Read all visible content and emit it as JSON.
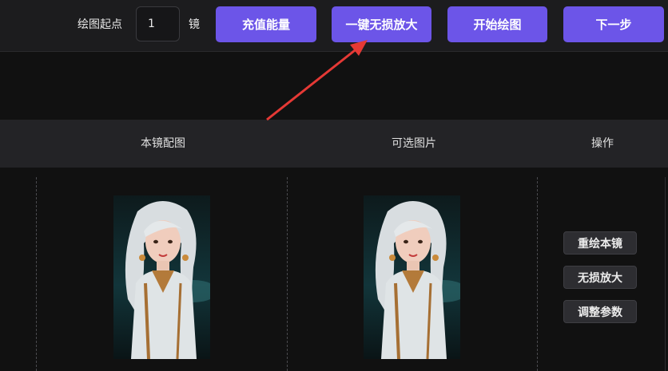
{
  "toolbar": {
    "start_label": "绘图起点",
    "start_value": "1",
    "unit_label": "镜",
    "recharge_label": "充值能量",
    "upscale_all_label": "一键无损放大",
    "start_draw_label": "开始绘图",
    "next_label": "下一步"
  },
  "table": {
    "columns": [
      "本镜配图",
      "可选图片",
      "操作"
    ],
    "row": {
      "actions": [
        "重绘本镜",
        "无损放大",
        "调整参数"
      ]
    }
  },
  "colors": {
    "accent": "#6c55e8",
    "annotation_arrow": "#e53935"
  }
}
